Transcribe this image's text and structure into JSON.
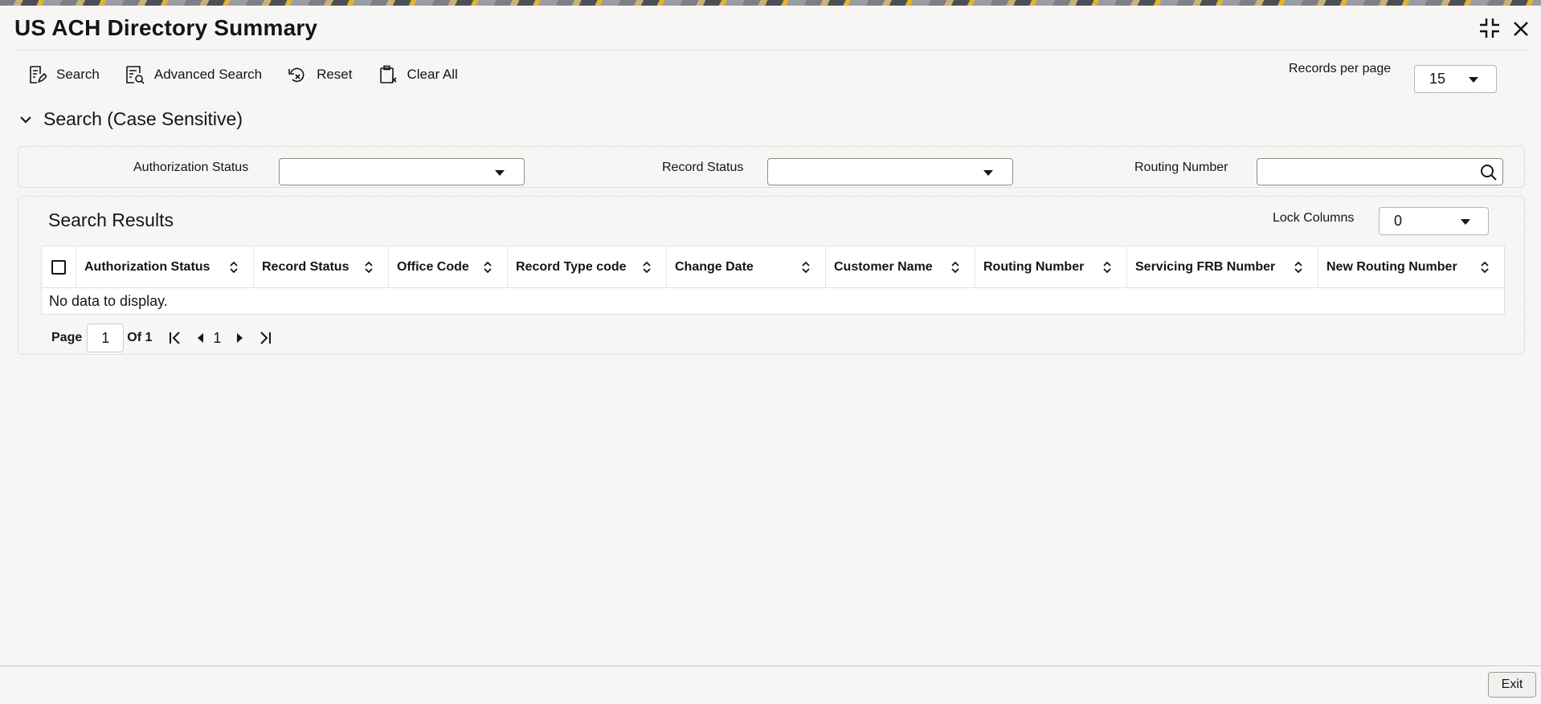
{
  "window": {
    "title": "US ACH Directory Summary",
    "controls": {
      "minimize_icon": "collapse-icon",
      "close_icon": "close-icon"
    }
  },
  "toolbar": {
    "search_label": "Search",
    "advanced_search_label": "Advanced Search",
    "reset_label": "Reset",
    "clear_all_label": "Clear All"
  },
  "records_per_page": {
    "label": "Records per page",
    "value": "15"
  },
  "search_section": {
    "title": "Search (Case Sensitive)",
    "fields": {
      "authorization_status": {
        "label": "Authorization Status",
        "value": ""
      },
      "record_status": {
        "label": "Record Status",
        "value": ""
      },
      "routing_number": {
        "label": "Routing Number",
        "value": ""
      }
    }
  },
  "results": {
    "title": "Search Results",
    "lock_columns": {
      "label": "Lock Columns",
      "value": "0"
    },
    "columns": [
      "Authorization Status",
      "Record Status",
      "Office Code",
      "Record Type code",
      "Change Date",
      "Customer Name",
      "Routing Number",
      "Servicing FRB Number",
      "New Routing Number"
    ],
    "rows": [],
    "empty_message": "No data to display."
  },
  "pagination": {
    "page_label": "Page",
    "current_page": "1",
    "of_label": "Of 1",
    "page_number": "1"
  },
  "footer": {
    "exit_label": "Exit"
  },
  "colors": {
    "text": "#161513",
    "background": "#f7f6f4",
    "border": "#e2e0dc"
  }
}
